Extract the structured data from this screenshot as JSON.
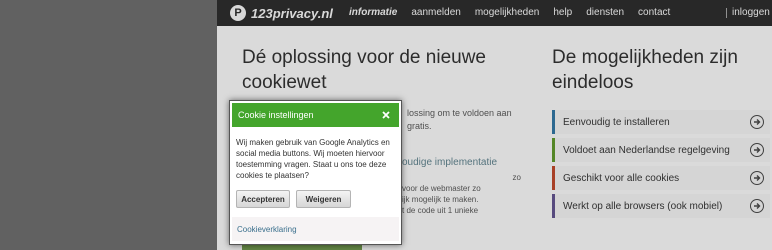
{
  "site": {
    "logo_text": "123privacy.nl",
    "logo_mark": "P",
    "nav": [
      {
        "label": "informatie",
        "active": true
      },
      {
        "label": "aanmelden",
        "active": false
      },
      {
        "label": "mogelijkheden",
        "active": false
      },
      {
        "label": "help",
        "active": false
      },
      {
        "label": "diensten",
        "active": false
      },
      {
        "label": "contact",
        "active": false
      }
    ],
    "login": "inloggen",
    "headline_left": "Dé oplossing voor de nieuwe cookiewet",
    "headline_right": "De mogelijkheden zijn eindeloos",
    "intro_line1": "lossing om te voldoen aan",
    "intro_line2": "gratis.",
    "impl_title": "oudige implementatie",
    "impl_line1": "zo",
    "impl_line2": "voor de webmaster zo",
    "impl_line3": "ijk mogelijk te maken.",
    "impl_line4": "t de code uit 1 unieke",
    "features": [
      {
        "label": "Eenvoudig te installeren",
        "accent": "#2f6f9a"
      },
      {
        "label": "Voldoet aan Nederlandse regelgeving",
        "accent": "#5a8f2a"
      },
      {
        "label": "Geschikt voor alle cookies",
        "accent": "#b3452a"
      },
      {
        "label": "Werkt op alle browsers (ook mobiel)",
        "accent": "#5d4f86"
      }
    ]
  },
  "dialog": {
    "title": "Cookie instellingen",
    "body": "Wij maken gebruik van Google Analytics en social media buttons. Wij moeten hiervoor toestemming vragen. Staat u ons toe deze cookies te plaatsen?",
    "accept_label": "Accepteren",
    "reject_label": "Weigeren",
    "link_label": "Cookieverklaring",
    "header_color": "#44a52c"
  }
}
